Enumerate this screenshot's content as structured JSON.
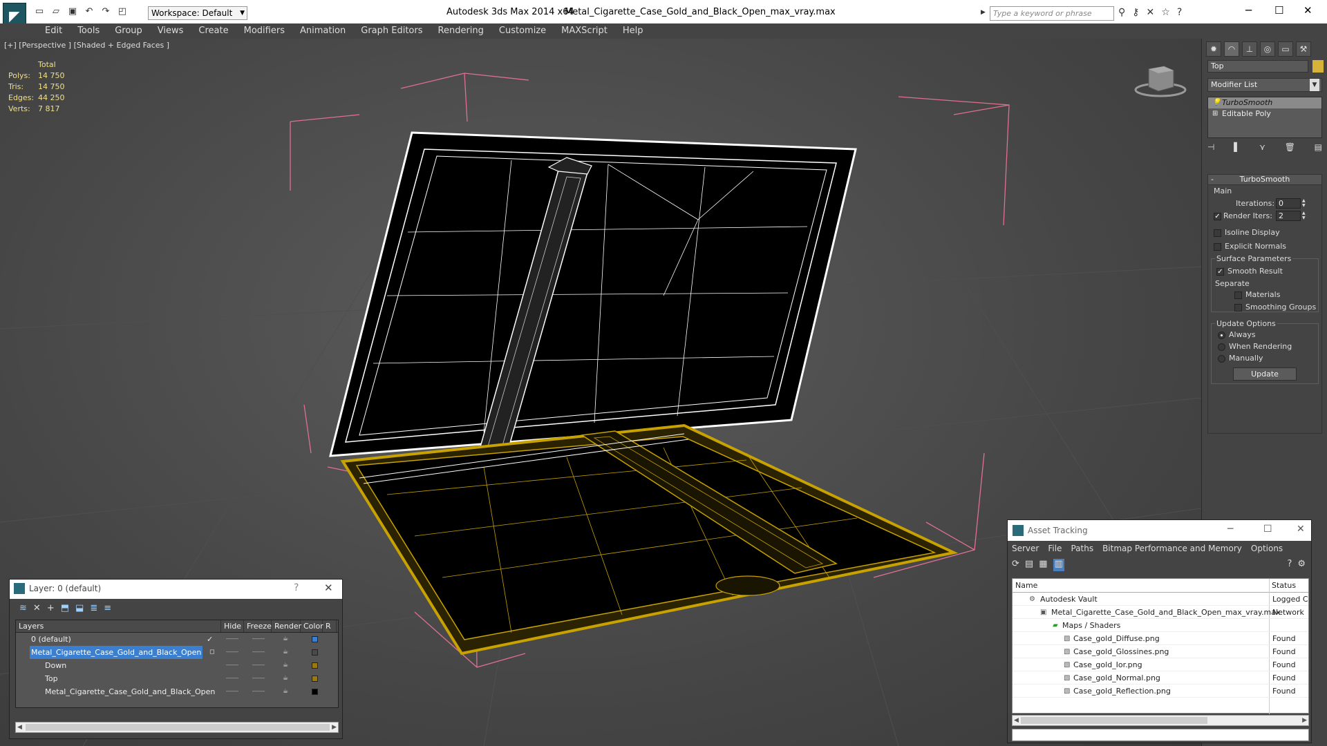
{
  "title": {
    "app": "Autodesk 3ds Max  2014 x64",
    "file": "Metal_Cigarette_Case_Gold_and_Black_Open_max_vray.max",
    "workspace": "Workspace: Default",
    "search_placeholder": "Type a keyword or phrase"
  },
  "menu": [
    "Edit",
    "Tools",
    "Group",
    "Views",
    "Create",
    "Modifiers",
    "Animation",
    "Graph Editors",
    "Rendering",
    "Customize",
    "MAXScript",
    "Help"
  ],
  "viewport": {
    "label": "[+] [Perspective ] [Shaded + Edged Faces ]",
    "stats_header": "Total",
    "stats": [
      {
        "label": "Polys:",
        "value": "14 750"
      },
      {
        "label": "Tris:",
        "value": "14 750"
      },
      {
        "label": "Edges:",
        "value": "44 250"
      },
      {
        "label": "Verts:",
        "value": "7 817"
      }
    ]
  },
  "command_panel": {
    "object_name": "Top",
    "modifier_list": "Modifier List",
    "stack": [
      "TurboSmooth",
      "Editable Poly"
    ],
    "rollout_title": "TurboSmooth",
    "main_label": "Main",
    "iterations_label": "Iterations:",
    "iterations_value": "0",
    "render_iters_label": "Render Iters:",
    "render_iters_value": "2",
    "isoline_label": "Isoline Display",
    "explicit_normals_label": "Explicit Normals",
    "surface_params_label": "Surface Parameters",
    "smooth_result_label": "Smooth Result",
    "separate_label": "Separate",
    "materials_label": "Materials",
    "smoothing_groups_label": "Smoothing Groups",
    "update_options_label": "Update Options",
    "always_label": "Always",
    "when_rendering_label": "When Rendering",
    "manually_label": "Manually",
    "update_button": "Update"
  },
  "layer_dialog": {
    "title": "Layer: 0 (default)",
    "columns": [
      "Layers",
      "Hide",
      "Freeze",
      "Render",
      "Color",
      "R"
    ],
    "rows": [
      {
        "name": "0 (default)",
        "color": "#3a7fd0"
      },
      {
        "name": "Metal_Cigarette_Case_Gold_and_Black_Open",
        "color": "#4a4a4a"
      },
      {
        "name": "Down",
        "color": "#9a7a10"
      },
      {
        "name": "Top",
        "color": "#9a7a10"
      },
      {
        "name": "Metal_Cigarette_Case_Gold_and_Black_Open",
        "color": "#000000"
      }
    ]
  },
  "asset_tracking": {
    "title": "Asset Tracking",
    "menu": [
      "Server",
      "File",
      "Paths",
      "Bitmap Performance and Memory",
      "Options"
    ],
    "columns": [
      "Name",
      "Status"
    ],
    "rows": [
      {
        "name": "Autodesk Vault",
        "status": "Logged C"
      },
      {
        "name": "Metal_Cigarette_Case_Gold_and_Black_Open_max_vray.max",
        "status": "Network"
      },
      {
        "name": "Maps / Shaders",
        "status": ""
      },
      {
        "name": "Case_gold_Diffuse.png",
        "status": "Found"
      },
      {
        "name": "Case_gold_Glossines.png",
        "status": "Found"
      },
      {
        "name": "Case_gold_Ior.png",
        "status": "Found"
      },
      {
        "name": "Case_gold_Normal.png",
        "status": "Found"
      },
      {
        "name": "Case_gold_Reflection.png",
        "status": "Found"
      }
    ]
  },
  "colors": {
    "selection_wire": "#ffffff",
    "object_wire": "#c8a200",
    "bounding_bracket": "#e07090",
    "object_color_swatch": "#d6b43a"
  }
}
